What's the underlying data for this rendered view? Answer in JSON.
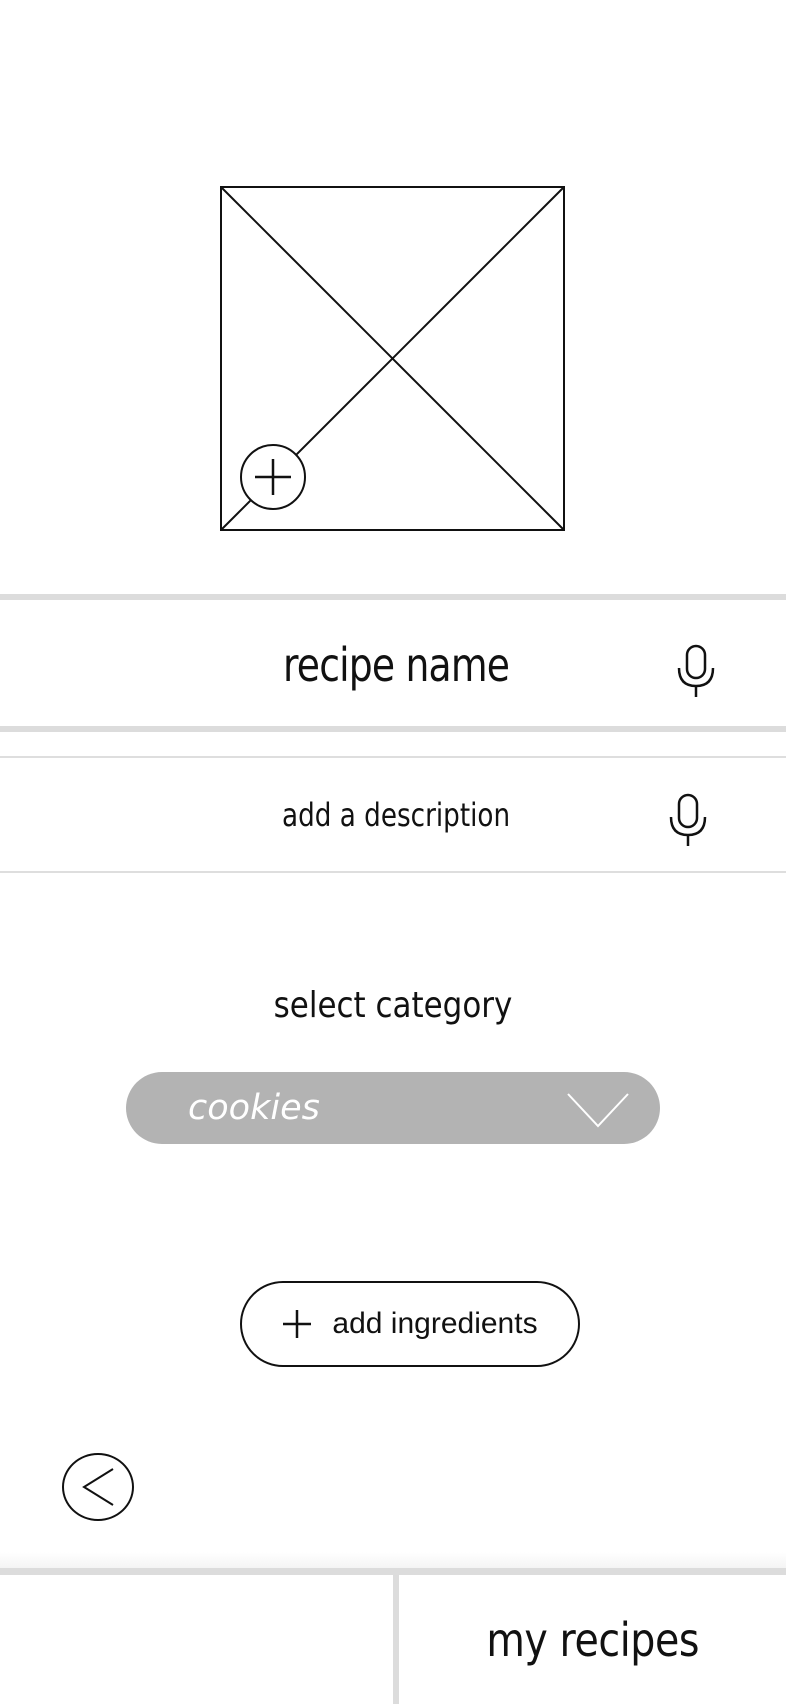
{
  "image_placeholder": {
    "add_icon": "plus-icon"
  },
  "recipe_name": {
    "placeholder": "recipe name",
    "mic_icon": "microphone-icon"
  },
  "description": {
    "placeholder": "add a description",
    "mic_icon": "microphone-icon"
  },
  "category": {
    "label": "select category",
    "selected": "cookies",
    "dropdown_icon": "chevron-down-icon",
    "color": "#b3b3b3"
  },
  "ingredients": {
    "button_label": "add ingredients",
    "icon": "plus-icon"
  },
  "back": {
    "icon": "chevron-left-icon"
  },
  "bottom_nav": {
    "right_label": "my recipes"
  }
}
